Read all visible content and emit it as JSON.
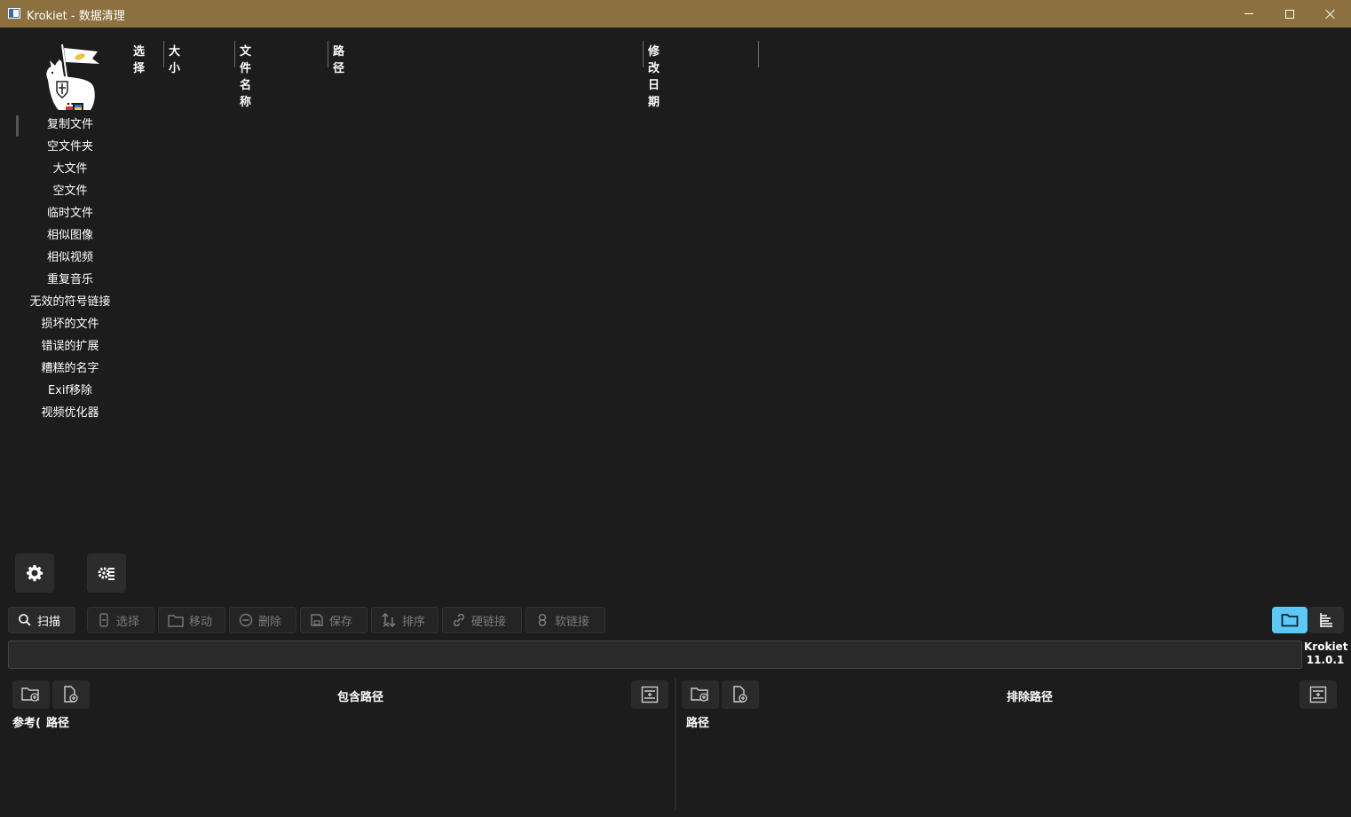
{
  "window": {
    "title": "Krokiet - 数据清理"
  },
  "sidebar": {
    "items": [
      {
        "label": "复制文件"
      },
      {
        "label": "空文件夹"
      },
      {
        "label": "大文件"
      },
      {
        "label": "空文件"
      },
      {
        "label": "临时文件"
      },
      {
        "label": "相似图像"
      },
      {
        "label": "相似视频"
      },
      {
        "label": "重复音乐"
      },
      {
        "label": "无效的符号链接"
      },
      {
        "label": "损坏的文件"
      },
      {
        "label": "错误的扩展"
      },
      {
        "label": "糟糕的名字"
      },
      {
        "label": "Exif移除"
      },
      {
        "label": "视频优化器"
      }
    ]
  },
  "table": {
    "columns": [
      "选择",
      "大小",
      "文件名称",
      "路径",
      "修改日期"
    ]
  },
  "toolbar": {
    "scan": "扫描",
    "select": "选择",
    "move": "移动",
    "delete": "删除",
    "save": "保存",
    "sort": "排序",
    "hardlink": "硬链接",
    "softlink": "软链接"
  },
  "status": {
    "app_name": "Krokiet",
    "version": "11.0.1"
  },
  "included": {
    "title": "包含路径",
    "col_reference": "参考(",
    "col_path": "路径"
  },
  "excluded": {
    "title": "排除路径",
    "col_path": "路径"
  },
  "colors": {
    "background": "#1c1c1c",
    "titlebar": "#8c7040",
    "accent": "#5bc8f5"
  }
}
